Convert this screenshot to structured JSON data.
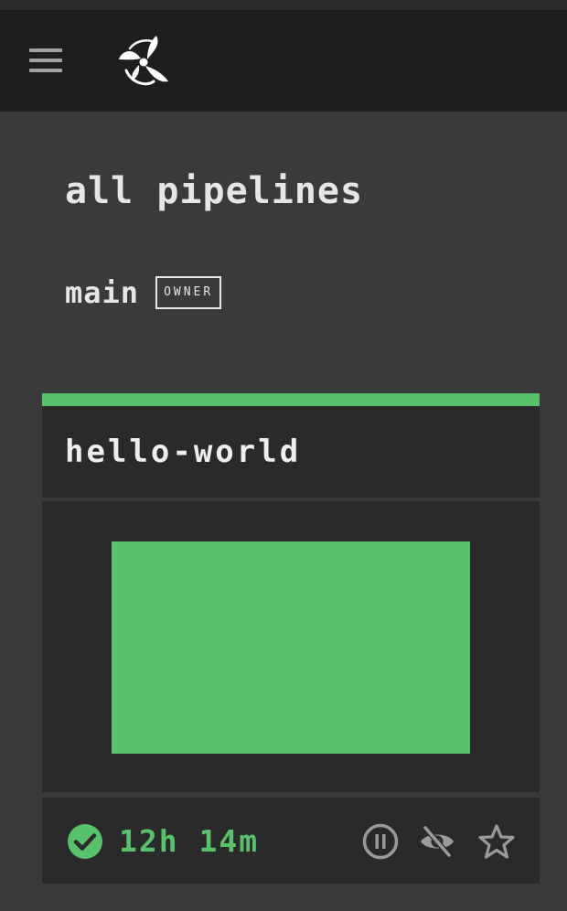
{
  "header": {
    "menu_icon": "hamburger-icon",
    "logo_icon": "concourse-propeller-logo"
  },
  "dashboard": {
    "title": "all pipelines",
    "team": {
      "name": "main",
      "role_badge": "OWNER"
    }
  },
  "pipeline_card": {
    "name": "hello-world",
    "status": "succeeded",
    "status_icon": "check-circle-icon",
    "duration": "12h 14m",
    "actions": [
      {
        "name": "pause",
        "icon": "pause-circle-icon"
      },
      {
        "name": "hide",
        "icon": "eye-off-icon"
      },
      {
        "name": "favorite",
        "icon": "star-outline-icon"
      }
    ]
  },
  "colors": {
    "background": "#3a3a3a",
    "topbar": "#1e1e1e",
    "card": "#2a2a2a",
    "success": "#59c16b",
    "text": "#e6e6e6",
    "icon_muted": "#9a9a9a"
  }
}
